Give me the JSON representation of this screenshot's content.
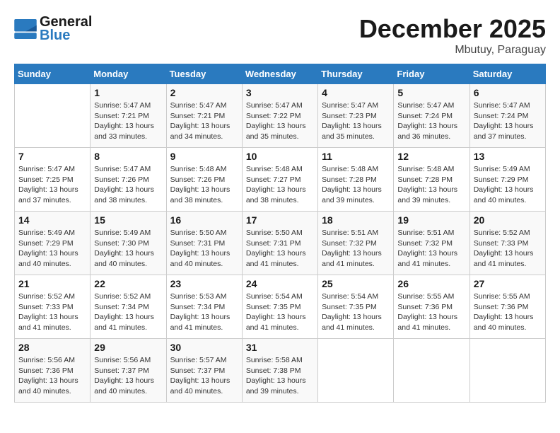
{
  "header": {
    "logo_line1": "General",
    "logo_line2": "Blue",
    "month": "December 2025",
    "location": "Mbutuy, Paraguay"
  },
  "days_of_week": [
    "Sunday",
    "Monday",
    "Tuesday",
    "Wednesday",
    "Thursday",
    "Friday",
    "Saturday"
  ],
  "weeks": [
    [
      {
        "day": "",
        "info": ""
      },
      {
        "day": "1",
        "info": "Sunrise: 5:47 AM\nSunset: 7:21 PM\nDaylight: 13 hours\nand 33 minutes."
      },
      {
        "day": "2",
        "info": "Sunrise: 5:47 AM\nSunset: 7:21 PM\nDaylight: 13 hours\nand 34 minutes."
      },
      {
        "day": "3",
        "info": "Sunrise: 5:47 AM\nSunset: 7:22 PM\nDaylight: 13 hours\nand 35 minutes."
      },
      {
        "day": "4",
        "info": "Sunrise: 5:47 AM\nSunset: 7:23 PM\nDaylight: 13 hours\nand 35 minutes."
      },
      {
        "day": "5",
        "info": "Sunrise: 5:47 AM\nSunset: 7:24 PM\nDaylight: 13 hours\nand 36 minutes."
      },
      {
        "day": "6",
        "info": "Sunrise: 5:47 AM\nSunset: 7:24 PM\nDaylight: 13 hours\nand 37 minutes."
      }
    ],
    [
      {
        "day": "7",
        "info": "Sunrise: 5:47 AM\nSunset: 7:25 PM\nDaylight: 13 hours\nand 37 minutes."
      },
      {
        "day": "8",
        "info": "Sunrise: 5:47 AM\nSunset: 7:26 PM\nDaylight: 13 hours\nand 38 minutes."
      },
      {
        "day": "9",
        "info": "Sunrise: 5:48 AM\nSunset: 7:26 PM\nDaylight: 13 hours\nand 38 minutes."
      },
      {
        "day": "10",
        "info": "Sunrise: 5:48 AM\nSunset: 7:27 PM\nDaylight: 13 hours\nand 38 minutes."
      },
      {
        "day": "11",
        "info": "Sunrise: 5:48 AM\nSunset: 7:28 PM\nDaylight: 13 hours\nand 39 minutes."
      },
      {
        "day": "12",
        "info": "Sunrise: 5:48 AM\nSunset: 7:28 PM\nDaylight: 13 hours\nand 39 minutes."
      },
      {
        "day": "13",
        "info": "Sunrise: 5:49 AM\nSunset: 7:29 PM\nDaylight: 13 hours\nand 40 minutes."
      }
    ],
    [
      {
        "day": "14",
        "info": "Sunrise: 5:49 AM\nSunset: 7:29 PM\nDaylight: 13 hours\nand 40 minutes."
      },
      {
        "day": "15",
        "info": "Sunrise: 5:49 AM\nSunset: 7:30 PM\nDaylight: 13 hours\nand 40 minutes."
      },
      {
        "day": "16",
        "info": "Sunrise: 5:50 AM\nSunset: 7:31 PM\nDaylight: 13 hours\nand 40 minutes."
      },
      {
        "day": "17",
        "info": "Sunrise: 5:50 AM\nSunset: 7:31 PM\nDaylight: 13 hours\nand 41 minutes."
      },
      {
        "day": "18",
        "info": "Sunrise: 5:51 AM\nSunset: 7:32 PM\nDaylight: 13 hours\nand 41 minutes."
      },
      {
        "day": "19",
        "info": "Sunrise: 5:51 AM\nSunset: 7:32 PM\nDaylight: 13 hours\nand 41 minutes."
      },
      {
        "day": "20",
        "info": "Sunrise: 5:52 AM\nSunset: 7:33 PM\nDaylight: 13 hours\nand 41 minutes."
      }
    ],
    [
      {
        "day": "21",
        "info": "Sunrise: 5:52 AM\nSunset: 7:33 PM\nDaylight: 13 hours\nand 41 minutes."
      },
      {
        "day": "22",
        "info": "Sunrise: 5:52 AM\nSunset: 7:34 PM\nDaylight: 13 hours\nand 41 minutes."
      },
      {
        "day": "23",
        "info": "Sunrise: 5:53 AM\nSunset: 7:34 PM\nDaylight: 13 hours\nand 41 minutes."
      },
      {
        "day": "24",
        "info": "Sunrise: 5:54 AM\nSunset: 7:35 PM\nDaylight: 13 hours\nand 41 minutes."
      },
      {
        "day": "25",
        "info": "Sunrise: 5:54 AM\nSunset: 7:35 PM\nDaylight: 13 hours\nand 41 minutes."
      },
      {
        "day": "26",
        "info": "Sunrise: 5:55 AM\nSunset: 7:36 PM\nDaylight: 13 hours\nand 41 minutes."
      },
      {
        "day": "27",
        "info": "Sunrise: 5:55 AM\nSunset: 7:36 PM\nDaylight: 13 hours\nand 40 minutes."
      }
    ],
    [
      {
        "day": "28",
        "info": "Sunrise: 5:56 AM\nSunset: 7:36 PM\nDaylight: 13 hours\nand 40 minutes."
      },
      {
        "day": "29",
        "info": "Sunrise: 5:56 AM\nSunset: 7:37 PM\nDaylight: 13 hours\nand 40 minutes."
      },
      {
        "day": "30",
        "info": "Sunrise: 5:57 AM\nSunset: 7:37 PM\nDaylight: 13 hours\nand 40 minutes."
      },
      {
        "day": "31",
        "info": "Sunrise: 5:58 AM\nSunset: 7:38 PM\nDaylight: 13 hours\nand 39 minutes."
      },
      {
        "day": "",
        "info": ""
      },
      {
        "day": "",
        "info": ""
      },
      {
        "day": "",
        "info": ""
      }
    ]
  ]
}
